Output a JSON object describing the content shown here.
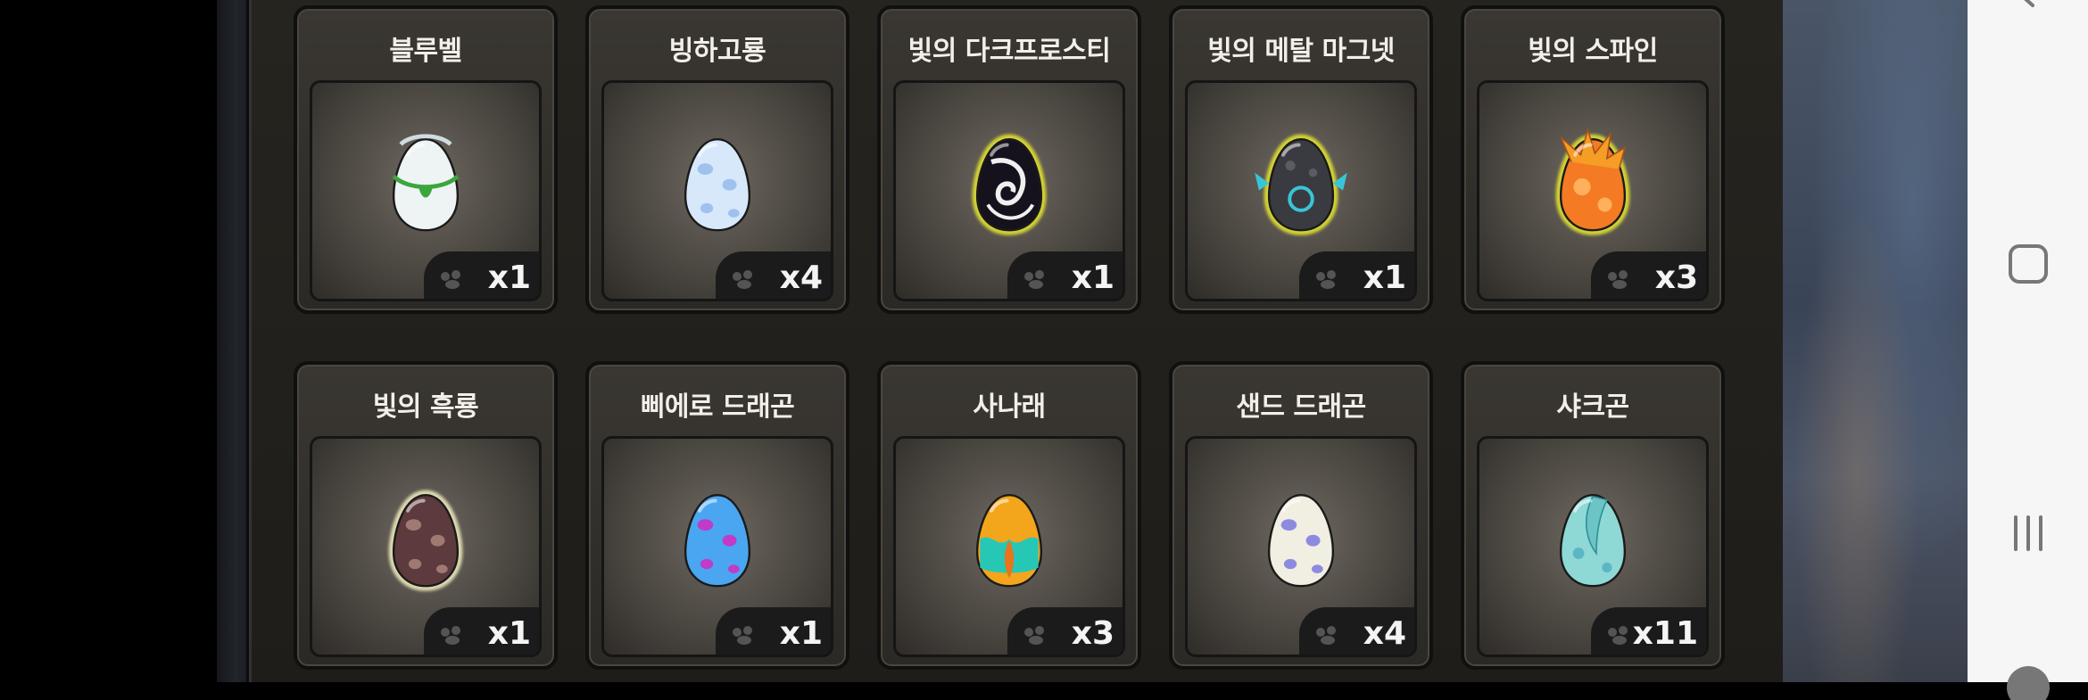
{
  "eggs": [
    {
      "name": "블루벨",
      "qty": "x1",
      "icon": "bluebell-egg-icon",
      "style": "leaf",
      "base": "#eef3f4",
      "spot": "#cfdde0",
      "glow": "",
      "deco": "#3aa63b"
    },
    {
      "name": "빙하고룡",
      "qty": "x4",
      "icon": "glacier-dragon-egg-icon",
      "style": "plain",
      "base": "#d8e8fb",
      "spot": "#9fc1ee",
      "glow": "",
      "deco": ""
    },
    {
      "name": "빛의 다크프로스티",
      "qty": "x1",
      "icon": "light-dark-frosty-egg-icon",
      "style": "swirl",
      "base": "#15121e",
      "spot": "#f0f0f0",
      "glow": "#e8e830",
      "deco": ""
    },
    {
      "name": "빛의 메탈 마그넷",
      "qty": "x1",
      "icon": "light-metal-magnet-egg-icon",
      "style": "metal",
      "base": "#3a3b40",
      "spot": "#5a5c63",
      "glow": "#e8e830",
      "deco": "#39c5d8"
    },
    {
      "name": "빛의 스파인",
      "qty": "x3",
      "icon": "light-spine-egg-icon",
      "style": "spine",
      "base": "#f47a24",
      "spot": "#ffb05a",
      "glow": "#e8e830",
      "deco": "#f59d24"
    },
    {
      "name": "빛의 흑룡",
      "qty": "x1",
      "icon": "light-black-dragon-egg-icon",
      "style": "plain",
      "base": "#5c3a3d",
      "spot": "#a07a72",
      "glow": "#f3efc0",
      "deco": ""
    },
    {
      "name": "삐에로 드래곤",
      "qty": "x1",
      "icon": "pierrot-dragon-egg-icon",
      "style": "plain",
      "base": "#4aa6f0",
      "spot": "#c13ac8",
      "glow": "",
      "deco": ""
    },
    {
      "name": "사나래",
      "qty": "x3",
      "icon": "sanarae-egg-icon",
      "style": "flame",
      "base": "#f3a51c",
      "spot": "#27c7b5",
      "glow": "",
      "deco": "#e8741c"
    },
    {
      "name": "샌드 드래곤",
      "qty": "x4",
      "icon": "sand-dragon-egg-icon",
      "style": "plain",
      "base": "#f1eee2",
      "spot": "#8c8be0",
      "glow": "",
      "deco": ""
    },
    {
      "name": "샤크곤",
      "qty": "x11",
      "icon": "sharkgon-egg-icon",
      "style": "fin",
      "base": "#8ed8d6",
      "spot": "#5bb7c3",
      "glow": "",
      "deco": "#6cc4c4"
    }
  ],
  "nav": {
    "back": "back-icon",
    "home": "home-icon",
    "recents": "recents-icon"
  }
}
